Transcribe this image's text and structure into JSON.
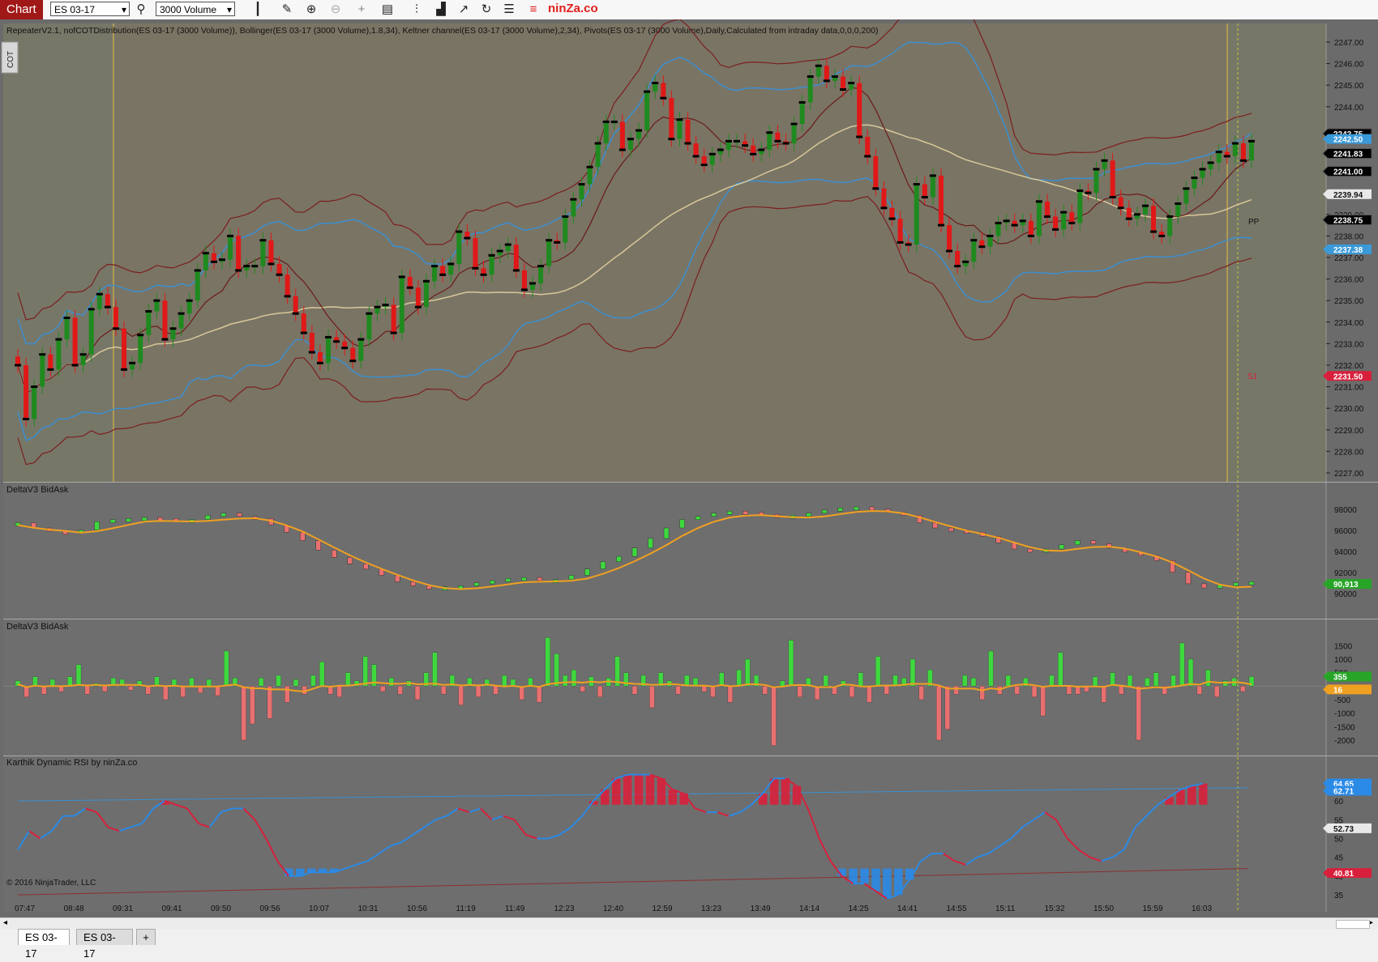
{
  "toolbar": {
    "chart_label": "Chart",
    "instrument": "ES 03-17",
    "bar_type": "3000 Volume",
    "brand": "ninZa.co",
    "icons": [
      "search-icon",
      "bar-style-icon",
      "draw-icon",
      "zoom-in-icon",
      "zoom-out-icon",
      "crosshair-icon",
      "data-box-icon",
      "chart-style-icon",
      "instrument-icon",
      "strategy-icon",
      "reload-icon",
      "properties-icon",
      "menu-icon"
    ]
  },
  "price_panel": {
    "title": "RepeaterV2.1, nofCOTDistribution(ES 03-17 (3000 Volume)), Bollinger(ES 03-17 (3000 Volume),1.8,34), Keltner channel(ES 03-17 (3000 Volume),2,34), Pivots(ES 03-17 (3000 Volume),Daily,Calculated from intraday data,0,0,0,200)",
    "cot_label": "COT",
    "pp_label": "PP",
    "s1_label": "S1",
    "axis_ticks": [
      "2247.00",
      "2246.00",
      "2245.00",
      "2244.00",
      "2241.00",
      "2240.00",
      "2239.00",
      "2238.00",
      "2237.00",
      "2236.00",
      "2235.00",
      "2234.00",
      "2233.00",
      "2232.00",
      "2231.00",
      "2230.00",
      "2229.00",
      "2228.00",
      "2227.00"
    ],
    "markers": [
      {
        "text": "2242.75",
        "color": "#000000"
      },
      {
        "text": "2242.50",
        "color": "#3a9ad9"
      },
      {
        "text": "2241.83",
        "color": "#000000"
      },
      {
        "text": "2241.00",
        "color": "#000000"
      },
      {
        "text": "2239.94",
        "color": "#e8e8e8"
      },
      {
        "text": "2238.75",
        "color": "#000000"
      },
      {
        "text": "2237.38",
        "color": "#3a9ad9"
      },
      {
        "text": "2231.50",
        "color": "#d8203c"
      }
    ]
  },
  "delta_panel": {
    "title": "DeltaV3 BidAsk",
    "axis_ticks": [
      "98000",
      "96000",
      "94000",
      "92000",
      "90000"
    ],
    "marker": "90,913"
  },
  "delta_bar_panel": {
    "title": "DeltaV3 BidAsk",
    "axis_ticks": [
      "1500",
      "1000",
      "500",
      "-500",
      "-1000",
      "-1500",
      "-2000"
    ],
    "markers": [
      {
        "text": "355",
        "color": "#27a527"
      },
      {
        "text": "16",
        "color": "#f0a020"
      }
    ]
  },
  "rsi_panel": {
    "title": "Karthik Dynamic RSI by ninZa.co",
    "axis_ticks": [
      "65",
      "60",
      "55",
      "50",
      "45",
      "40",
      "35"
    ],
    "markers": [
      {
        "text": "64.65",
        "color": "#2a8ae6"
      },
      {
        "text": "62.71",
        "color": "#2a8ae6"
      },
      {
        "text": "52.73",
        "color": "#e8e8e8"
      },
      {
        "text": "40.81",
        "color": "#d8203c"
      }
    ],
    "copyright": "© 2016 NinjaTrader, LLC"
  },
  "time_axis": [
    "07:47",
    "08:48",
    "09:31",
    "09:41",
    "09:50",
    "09:56",
    "10:07",
    "10:31",
    "10:56",
    "11:19",
    "11:49",
    "12:23",
    "12:40",
    "12:59",
    "13:23",
    "13:49",
    "14:14",
    "14:25",
    "14:41",
    "14:55",
    "15:11",
    "15:32",
    "15:50",
    "15:59",
    "16:03"
  ],
  "tabs": [
    "ES 03-17",
    "ES 03-17"
  ],
  "chart_data": [
    {
      "type": "candlestick",
      "title": "RepeaterV2.1, nofCOTDistribution(ES 03-17 (3000 Volume)), Bollinger(ES 03-17 (3000 Volume),1.8,34), Keltner channel(ES 03-17 (3000 Volume),2,34), Pivots(ES 03-17 (3000 Volume),Daily,Calculated from intraday data,0,0,0,200)",
      "ylim": [
        2227.0,
        2247.3
      ],
      "bars": 142,
      "close": [
        2232.0,
        2229.5,
        2231.0,
        2232.5,
        2231.8,
        2233.2,
        2234.2,
        2232.0,
        2232.5,
        2234.6,
        2235.3,
        2234.7,
        2233.7,
        2231.8,
        2232.1,
        2233.4,
        2234.5,
        2235.0,
        2233.2,
        2233.7,
        2234.4,
        2235.0,
        2236.4,
        2237.2,
        2236.8,
        2236.9,
        2238.0,
        2236.4,
        2236.6,
        2236.6,
        2237.8,
        2236.7,
        2236.2,
        2235.2,
        2234.4,
        2233.5,
        2232.6,
        2232.1,
        2233.3,
        2233.1,
        2232.8,
        2232.2,
        2233.2,
        2234.4,
        2234.7,
        2234.8,
        2233.5,
        2236.1,
        2235.6,
        2234.7,
        2235.9,
        2236.6,
        2236.2,
        2236.7,
        2238.2,
        2237.9,
        2236.5,
        2236.2,
        2237.1,
        2237.3,
        2237.6,
        2236.4,
        2235.5,
        2235.8,
        2236.6,
        2237.8,
        2237.7,
        2238.9,
        2239.7,
        2240.4,
        2241.2,
        2242.3,
        2243.3,
        2243.3,
        2242.0,
        2242.5,
        2242.9,
        2244.7,
        2245.1,
        2244.4,
        2242.5,
        2243.4,
        2242.3,
        2241.7,
        2241.3,
        2241.8,
        2242.0,
        2242.4,
        2242.4,
        2242.2,
        2241.8,
        2242.0,
        2242.8,
        2242.4,
        2242.3,
        2243.2,
        2244.2,
        2245.4,
        2245.9,
        2245.2,
        2245.4,
        2244.8,
        2245.1,
        2242.6,
        2241.7,
        2240.2,
        2239.3,
        2238.8,
        2237.7,
        2237.6,
        2240.4,
        2239.8,
        2240.8,
        2238.5,
        2237.3,
        2236.6,
        2236.8,
        2237.8,
        2237.5,
        2238.0,
        2238.6,
        2238.7,
        2238.5,
        2238.7,
        2238.0,
        2239.6,
        2238.9,
        2238.3,
        2239.1,
        2238.6,
        2240.1,
        2240.0,
        2241.1,
        2241.5,
        2239.8,
        2239.3,
        2238.8,
        2239.0,
        2239.4,
        2238.2,
        2238.0,
        2238.9,
        2239.5,
        2240.2,
        2240.7,
        2241.1,
        2241.4,
        2241.9,
        2241.7,
        2242.3,
        2241.5,
        2242.4
      ]
    },
    {
      "type": "line",
      "title": "DeltaV3 BidAsk",
      "ylim": [
        89000,
        99000
      ],
      "series": [
        {
          "values": [
            96500,
            96000,
            95700,
            95600,
            95800,
            96600,
            96800,
            96900,
            97000,
            96900,
            96700,
            96800,
            97200,
            97400,
            97100,
            96900,
            96300,
            95600,
            94800,
            93900,
            93200,
            92600,
            92100,
            91500,
            90900,
            90500,
            90300,
            90400,
            90500,
            90800,
            91000,
            91200,
            91300,
            91000,
            91100,
            91500,
            92100,
            92800,
            93300,
            94100,
            95000,
            96000,
            96800,
            97100,
            97400,
            97600,
            97500,
            97300,
            97000,
            97200,
            97400,
            97700,
            97900,
            98000,
            97800,
            97500,
            97200,
            96500,
            96000,
            95800,
            95600,
            95200,
            94600,
            94000,
            93800,
            94000,
            94400,
            94800,
            94500,
            94100,
            93700,
            93400,
            92900,
            91800,
            90700,
            90300,
            90600,
            90800,
            90900
          ]
        }
      ]
    },
    {
      "type": "bar",
      "title": "DeltaV3 BidAsk",
      "ylim": [
        -2300,
        1900
      ],
      "values": [
        200,
        -400,
        350,
        -300,
        250,
        -200,
        350,
        800,
        -300,
        100,
        -200,
        300,
        250,
        -150,
        200,
        -300,
        350,
        -500,
        250,
        -400,
        300,
        -250,
        250,
        -350,
        1300,
        300,
        -2000,
        -1400,
        300,
        -1200,
        400,
        -600,
        250,
        -300,
        400,
        900,
        -300,
        -400,
        500,
        200,
        1100,
        800,
        -200,
        300,
        -300,
        200,
        -500,
        500,
        1250,
        -300,
        400,
        -700,
        300,
        -400,
        250,
        -300,
        400,
        250,
        -500,
        300,
        -600,
        1800,
        1200,
        400,
        600,
        -200,
        350,
        -400,
        300,
        1100,
        500,
        -300,
        400,
        -800,
        500,
        200,
        -300,
        400,
        300,
        -200,
        -400,
        500,
        -600,
        600,
        1000,
        400,
        -300,
        -2200,
        200,
        1700,
        -400,
        300,
        -500,
        400,
        -300,
        200,
        -400,
        500,
        -600,
        1100,
        -300,
        400,
        300,
        1000,
        -500,
        600,
        -2000,
        -1600,
        -300,
        400,
        300,
        -500,
        1300,
        -300,
        400,
        -300,
        300,
        -400,
        -1100,
        400,
        1250,
        -300,
        -300,
        -200,
        350,
        -600,
        500,
        -300,
        400,
        -2000,
        300,
        500,
        -300,
        400,
        1600,
        1000,
        -300,
        600,
        -400,
        200,
        300,
        -200,
        355
      ]
    },
    {
      "type": "line",
      "title": "Karthik Dynamic RSI by ninZa.co",
      "ylim": [
        32,
        68
      ],
      "series": [
        {
          "values": [
            47,
            52,
            50,
            52,
            56,
            56,
            58,
            57,
            53,
            52,
            53,
            54,
            58,
            60,
            59,
            58,
            54,
            53,
            57,
            58,
            58,
            55,
            50,
            44,
            40,
            40,
            41,
            41,
            41,
            42,
            43,
            44,
            46,
            48,
            49,
            51,
            53,
            55,
            56,
            58,
            57,
            58,
            55,
            56,
            55,
            51,
            50,
            50,
            51,
            53,
            56,
            60,
            63,
            66,
            67,
            67,
            67,
            66,
            63,
            62,
            58,
            57,
            57,
            56,
            57,
            59,
            62,
            66,
            66,
            64,
            58,
            50,
            44,
            40,
            38,
            38,
            36,
            34,
            35,
            39,
            44,
            46,
            46,
            44,
            43,
            45,
            46,
            48,
            50,
            53,
            55,
            57,
            55,
            50,
            47,
            45,
            44,
            45,
            47,
            53,
            56,
            59,
            61,
            63,
            64,
            64.65
          ]
        }
      ]
    }
  ]
}
